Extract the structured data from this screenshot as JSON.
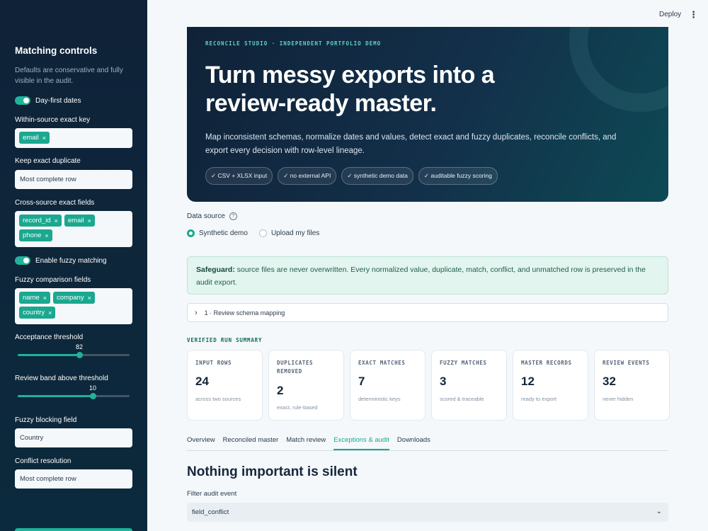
{
  "sidebar": {
    "title": "Matching controls",
    "description": "Defaults are conservative and fully visible in the audit.",
    "day_first_label": "Day-first dates",
    "within_source_label": "Within-source exact key",
    "within_source_chips": [
      "email"
    ],
    "keep_dup_label": "Keep exact duplicate",
    "keep_dup_value": "Most complete row",
    "cross_source_label": "Cross-source exact fields",
    "cross_source_chips": [
      "record_id",
      "email",
      "phone"
    ],
    "fuzzy_toggle_label": "Enable fuzzy matching",
    "fuzzy_fields_label": "Fuzzy comparison fields",
    "fuzzy_fields_chips": [
      "name",
      "company",
      "country"
    ],
    "acceptance_label": "Acceptance threshold",
    "acceptance_value": "82",
    "acceptance_fraction": 0.55,
    "review_band_label": "Review band above threshold",
    "review_band_value": "10",
    "review_band_fraction": 0.67,
    "blocking_label": "Fuzzy blocking field",
    "blocking_value": "Country",
    "conflict_label": "Conflict resolution",
    "conflict_value": "Most complete row"
  },
  "topbar": {
    "deploy": "Deploy",
    "menu_icon": "kebab-icon"
  },
  "hero": {
    "kicker": "RECONCILE STUDIO · INDEPENDENT PORTFOLIO DEMO",
    "title": "Turn messy exports into a review-ready master.",
    "body": "Map inconsistent schemas, normalize dates and values, detect exact and fuzzy duplicates, reconcile conflicts, and export every decision with row-level lineage.",
    "pills": [
      "✓ CSV + XLSX input",
      "✓ no external API",
      "✓ synthetic demo data",
      "✓ auditable fuzzy scoring"
    ]
  },
  "data_source": {
    "label": "Data source",
    "options": [
      "Synthetic demo",
      "Upload my files"
    ],
    "selected": "Synthetic demo"
  },
  "safeguard": {
    "bold": "Safeguard:",
    "text": " source files are never overwritten. Every normalized value, duplicate, match, conflict, and unmatched row is preserved in the audit export."
  },
  "expander": {
    "label": "1 · Review schema mapping"
  },
  "summary": {
    "title": "VERIFIED RUN SUMMARY",
    "cards": [
      {
        "label": "INPUT ROWS",
        "value": "24",
        "sub": "across two sources"
      },
      {
        "label": "DUPLICATES REMOVED",
        "value": "2",
        "sub": "exact, rule-based"
      },
      {
        "label": "EXACT MATCHES",
        "value": "7",
        "sub": "deterministic keys"
      },
      {
        "label": "FUZZY MATCHES",
        "value": "3",
        "sub": "scored & traceable"
      },
      {
        "label": "MASTER RECORDS",
        "value": "12",
        "sub": "ready to export"
      },
      {
        "label": "REVIEW EVENTS",
        "value": "32",
        "sub": "never hidden"
      }
    ]
  },
  "tabs": [
    "Overview",
    "Reconciled master",
    "Match review",
    "Exceptions & audit",
    "Downloads"
  ],
  "active_tab": "Exceptions & audit",
  "section": {
    "heading": "Nothing important is silent",
    "filter_label": "Filter audit event",
    "filter_value": "field_conflict"
  },
  "colors": {
    "accent": "#1aa890",
    "sidebar_bg": "#0f2238",
    "hero_bg": "#13304a"
  }
}
